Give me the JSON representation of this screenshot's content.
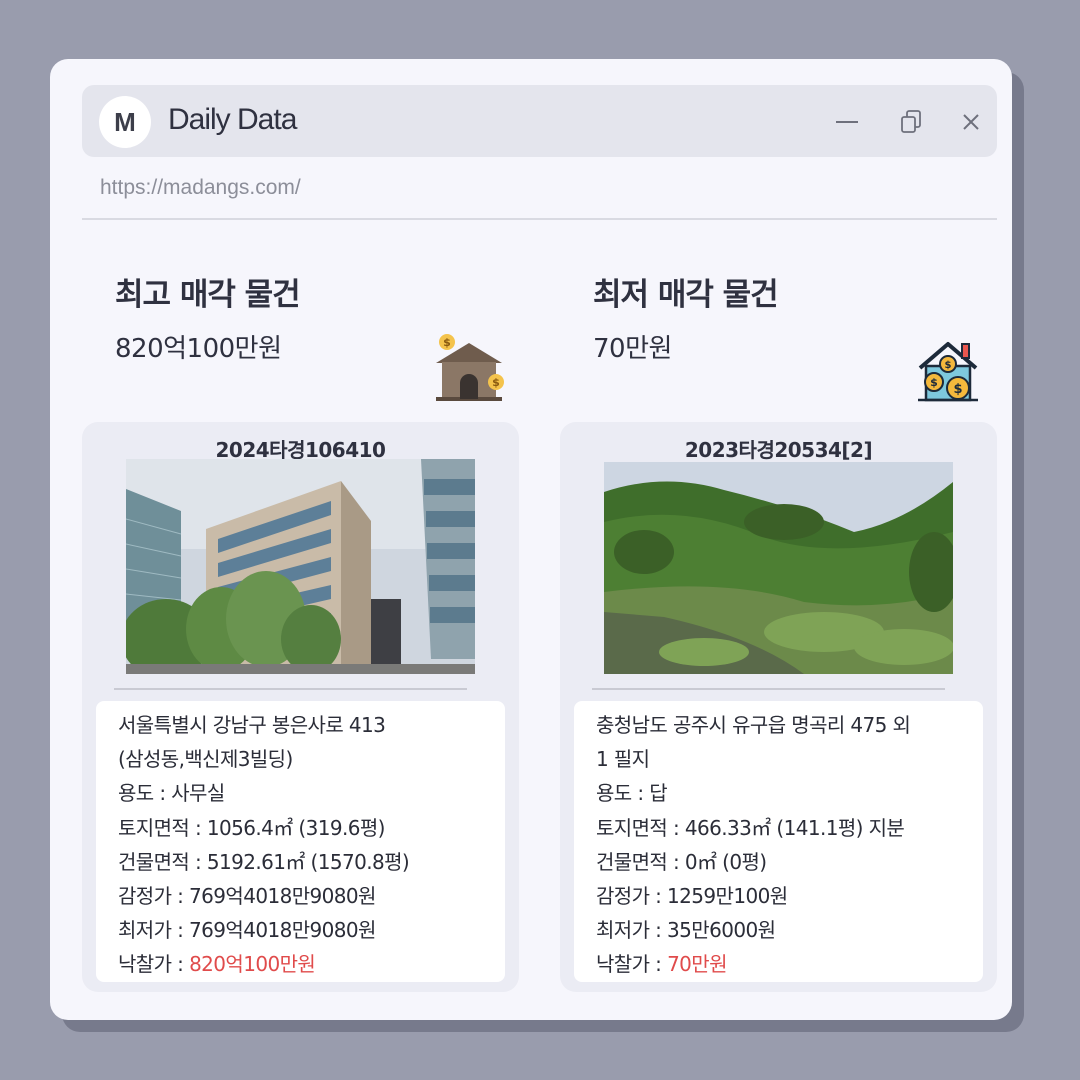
{
  "window": {
    "logo_letter": "M",
    "title": "Daily Data",
    "url": "https://madangs.com/",
    "controls": [
      "minimize-icon",
      "restore-icon",
      "close-icon"
    ]
  },
  "highest": {
    "heading": "최고 매각 물건",
    "price": "820억100만원",
    "card": {
      "case_number": "2024타경106410",
      "address_line1": "서울특별시 강남구 봉은사로 413",
      "address_line2": "(삼성동,백신제3빌딩)",
      "usage": "용도 : 사무실",
      "land_area": "토지면적 : 1056.4㎡ (319.6평)",
      "building_area": "건물면적 : 5192.61㎡ (1570.8평)",
      "appraisal": "감정가 : 769억4018만9080원",
      "minimum": "최저가 : 769억4018만9080원",
      "winning_label": "낙찰가 : ",
      "winning_value": "820억100만원"
    }
  },
  "lowest": {
    "heading": "최저 매각 물건",
    "price": "70만원",
    "card": {
      "case_number": "2023타경20534[2]",
      "address_line1": "충청남도 공주시 유구읍 명곡리 475 외",
      "address_line2": "1 필지",
      "usage": "용도 :  답",
      "land_area": "토지면적 : 466.33㎡ (141.1평) 지분",
      "building_area": "건물면적 : 0㎡ (0평)",
      "appraisal": "감정가 : 1259만100원",
      "minimum": "최저가 : 35만6000원",
      "winning_label": "낙찰가 : ",
      "winning_value": "70만원"
    }
  },
  "colors": {
    "background": "#999cad",
    "window": "#f6f6fc",
    "card": "#ebecf4",
    "highlight_red": "#e04b4b"
  }
}
